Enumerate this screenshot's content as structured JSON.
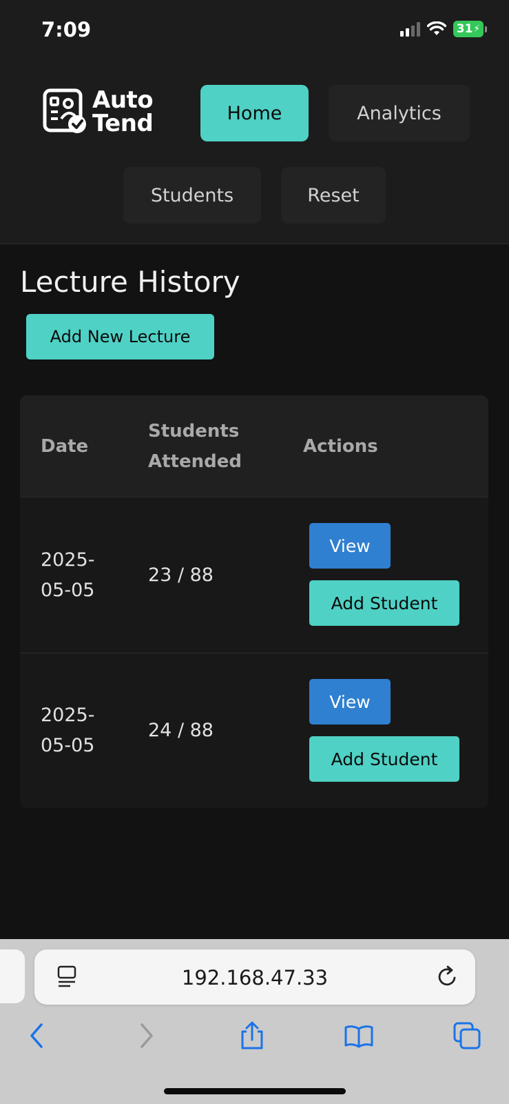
{
  "status_bar": {
    "time": "7:09",
    "battery": "31"
  },
  "header": {
    "logo_line1": "Auto",
    "logo_line2": "Tend",
    "nav": {
      "home": "Home",
      "analytics": "Analytics",
      "students": "Students",
      "reset": "Reset"
    }
  },
  "main": {
    "title": "Lecture History",
    "add_lecture_label": "Add New Lecture",
    "table": {
      "headers": {
        "date": "Date",
        "students_line1": "Students",
        "students_line2": "Attended",
        "actions": "Actions"
      },
      "rows": [
        {
          "date_line1": "2025-",
          "date_line2": "05-05",
          "attended": "23 / 88",
          "view_label": "View",
          "add_label": "Add Student"
        },
        {
          "date_line1": "2025-",
          "date_line2": "05-05",
          "attended": "24 / 88",
          "view_label": "View",
          "add_label": "Add Student"
        }
      ]
    }
  },
  "browser": {
    "url": "192.168.47.33"
  },
  "colors": {
    "accent": "#4fd1c5",
    "view_button": "#2f80d1",
    "background": "#121212",
    "header": "#1c1c1c"
  }
}
